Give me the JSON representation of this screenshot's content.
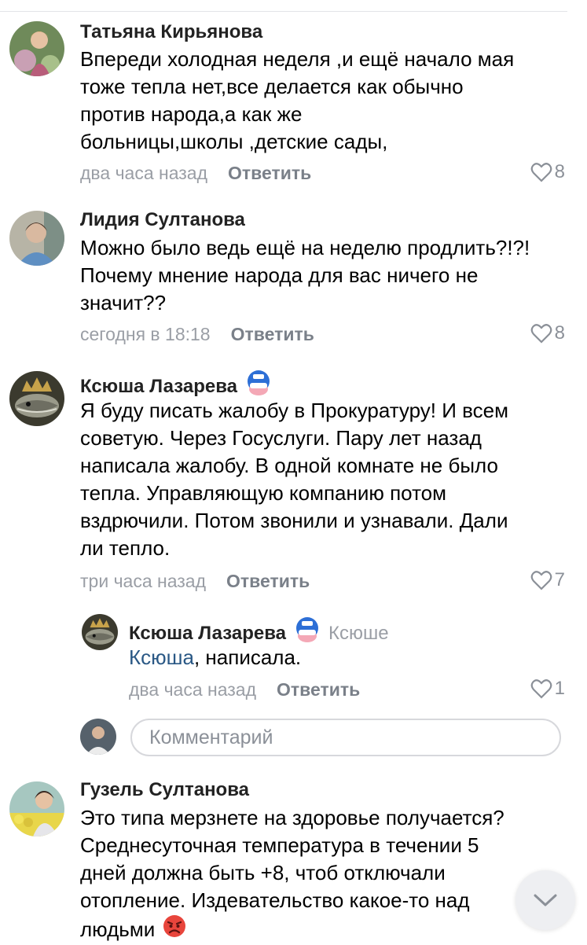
{
  "comments": [
    {
      "author": "Татьяна Кирьянова",
      "lines": [
        "Впереди холодная неделя ,и ещё начало мая",
        "тоже тепла нет,все делается как обычно",
        "против народа,а как же",
        "больницы,школы ,детские сады,"
      ],
      "time": "два часа назад",
      "reply_label": "Ответить",
      "likes": "8"
    },
    {
      "author": "Лидия Султанова",
      "lines": [
        "Можно было ведь ещё на неделю продлить?!?!",
        "Почему мнение народа для вас ничего не",
        "значит??"
      ],
      "time": "сегодня в 18:18",
      "reply_label": "Ответить",
      "likes": "8"
    },
    {
      "author": "Ксюша Лазарева",
      "lines": [
        "Я буду писать жалобу в Прокуратуру! И всем",
        "советую. Через Госуслуги. Пару лет назад",
        "написала жалобу. В одной комнате не было",
        "тепла. Управляющую компанию потом",
        "вздрючили. Потом звонили и узнавали. Дали",
        "ли тепло."
      ],
      "time": "три часа назад",
      "reply_label": "Ответить",
      "likes": "7"
    },
    {
      "author": "Гузель Султанова",
      "lines": [
        "Это типа мерзнете на здоровье получается?",
        "Среднесуточная температура в течении 5",
        "дней должна быть +8, чтоб отключали",
        "отопление. Издевательство какое-то над",
        "людьми"
      ]
    }
  ],
  "reply": {
    "author": "Ксюша Лазарева",
    "to": "Ксюше",
    "mention": "Ксюша",
    "text_rest": ", написала.",
    "time": "два часа назад",
    "reply_label": "Ответить",
    "likes": "1"
  },
  "comment_input": {
    "placeholder": "Комментарий"
  },
  "icons": [
    "heart-icon",
    "mask-badge-icon",
    "angry-emoji-icon",
    "chevron-down-icon"
  ],
  "colors": {
    "link": "#2a5885",
    "muted": "#9a9ea5",
    "reply": "#7a8089",
    "background": "#ffffff"
  }
}
